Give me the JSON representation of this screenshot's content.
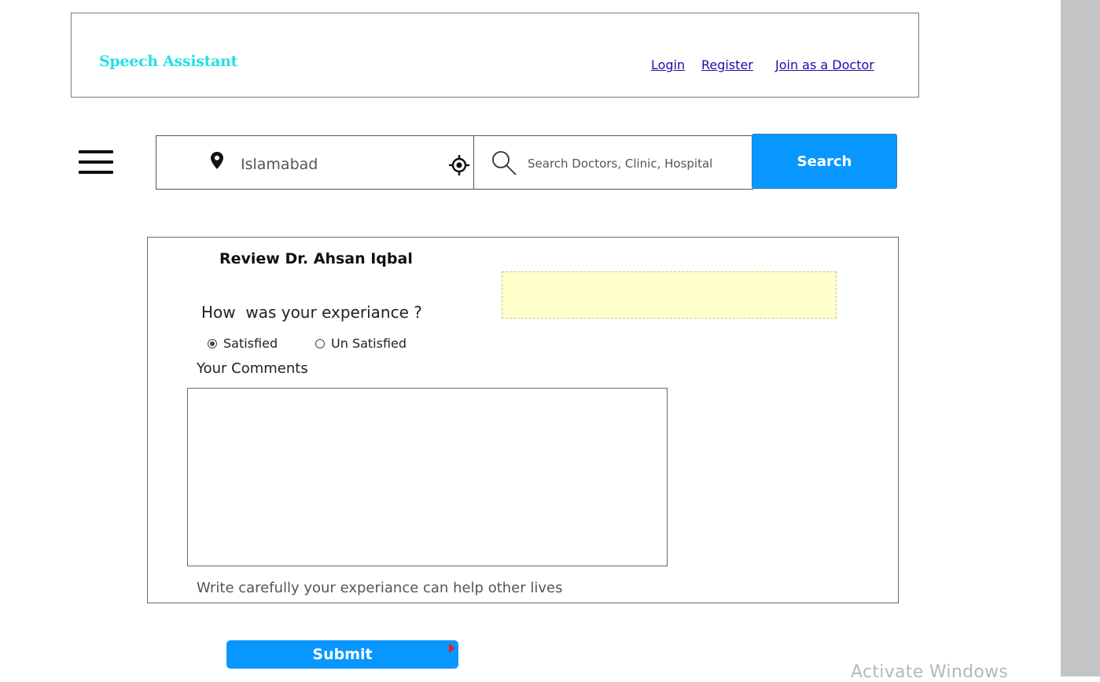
{
  "header": {
    "brand": "Speech Assistant",
    "links": {
      "login": "Login",
      "register": "Register",
      "join": "Join as a Doctor"
    },
    "brand_color": "#22e0e6"
  },
  "search": {
    "location": "Islamabad",
    "placeholder": "Search Doctors, Clinic, Hospital",
    "button_label": "Search",
    "button_color": "#0897ff"
  },
  "review": {
    "title": "Review Dr. Ahsan Iqbal",
    "question": "How  was your experiance ?",
    "options": [
      {
        "label": "Satisfied",
        "selected": true
      },
      {
        "label": "Un Satisfied",
        "selected": false
      }
    ],
    "comments_label": "Your Comments",
    "comments_value": "",
    "hint": "Write carefully your experiance can help other lives"
  },
  "submit": {
    "label": "Submit"
  },
  "watermark": "Activate Windows"
}
